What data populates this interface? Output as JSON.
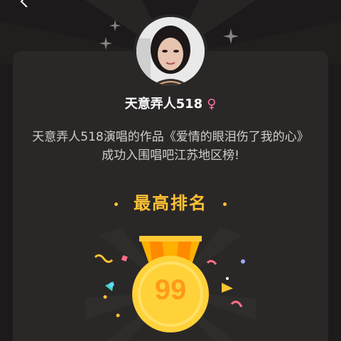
{
  "user": {
    "name": "天意弄人518",
    "gender_symbol": "♀"
  },
  "description": "天意弄人518演唱的作品《爱情的眼泪伤了我的心》成功入围唱吧江苏地区榜!",
  "rank": {
    "title": "最高排名",
    "value": "99"
  },
  "icons": {
    "back": "back-arrow-icon",
    "sparkle": "sparkle-icon",
    "medal": "medal-icon"
  },
  "colors": {
    "background": "#1c1a1a",
    "card": "#2a2727",
    "accent": "#ffc233",
    "gender": "#ff6fa6",
    "medal_number": "#ff9b1a"
  }
}
